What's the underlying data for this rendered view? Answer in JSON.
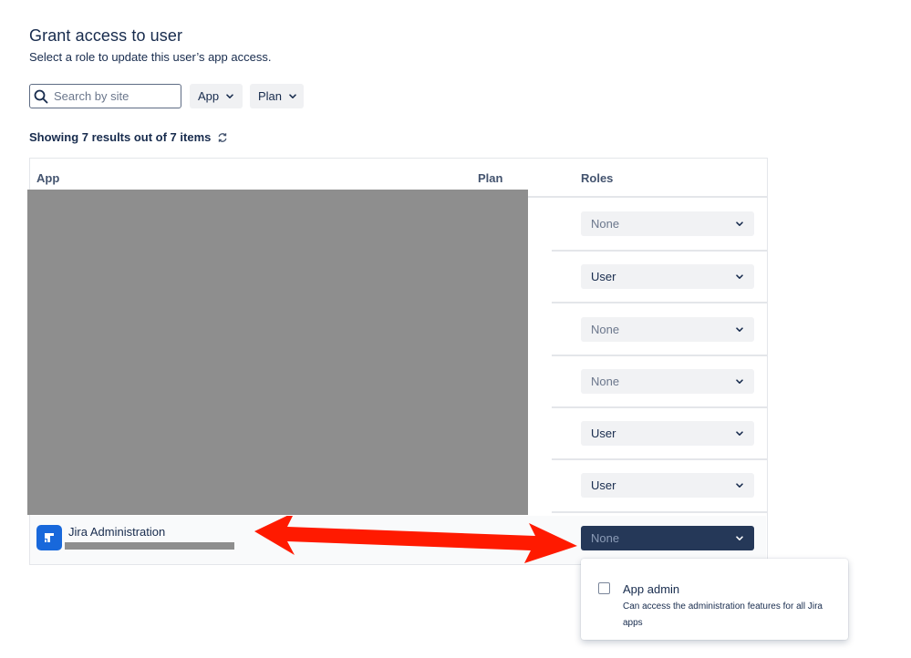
{
  "header": {
    "title": "Grant access to user",
    "subtitle": "Select a role to update this user’s app access."
  },
  "filters": {
    "search_placeholder": "Search by site",
    "app_label": "App",
    "plan_label": "Plan"
  },
  "results_text": "Showing 7 results out of 7 items",
  "table": {
    "columns": [
      "App",
      "Plan",
      "Roles"
    ],
    "rows": [
      {
        "app": "",
        "role": "None"
      },
      {
        "app": "",
        "role": "User"
      },
      {
        "app": "",
        "role": "None"
      },
      {
        "app": "",
        "role": "None"
      },
      {
        "app": "",
        "role": "User"
      },
      {
        "app": "",
        "role": "User"
      },
      {
        "app": "Jira Administration",
        "role": "None"
      }
    ]
  },
  "dropdown": {
    "option_label": "App admin",
    "option_description": "Can access the administration features for all Jira apps",
    "option_checked": false
  },
  "colors": {
    "active_select": "#253858",
    "jira_logo": "#1868db",
    "annotation_arrow": "#ff1a00",
    "redaction": "#8e8e8e"
  }
}
